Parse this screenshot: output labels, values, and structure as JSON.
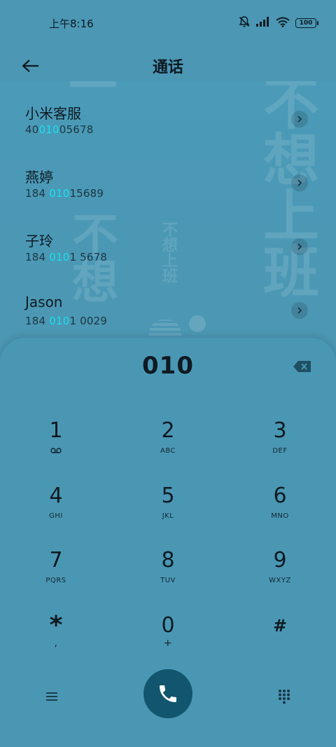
{
  "status_bar": {
    "time": "上午8:16",
    "battery": "100",
    "icons": [
      "mute-bell-icon",
      "signal-icon",
      "wifi-icon",
      "battery-icon"
    ]
  },
  "header": {
    "title": "通话",
    "back_icon": "arrow-left-icon"
  },
  "wallpaper": {
    "texts": [
      "不想上班",
      "不想上班",
      "不想"
    ]
  },
  "contacts": [
    {
      "name": "小米客服",
      "number_pre": "40",
      "number_match": "010",
      "number_post": "05678"
    },
    {
      "name": "燕婷",
      "number_pre": "184 ",
      "number_match": "010",
      "number_post": "15689"
    },
    {
      "name": "子玲",
      "number_pre": "184 ",
      "number_match": "010",
      "number_post": "1 5678"
    },
    {
      "name": "Jason",
      "number_pre": "184 ",
      "number_match": "010",
      "number_post": "1 0029"
    }
  ],
  "dialer": {
    "input": "010",
    "delete_icon": "backspace-icon",
    "keys": [
      {
        "digit": "1",
        "sub": ""
      },
      {
        "digit": "2",
        "sub": "ABC"
      },
      {
        "digit": "3",
        "sub": "DEF"
      },
      {
        "digit": "4",
        "sub": "GHI"
      },
      {
        "digit": "5",
        "sub": "JKL"
      },
      {
        "digit": "6",
        "sub": "MNO"
      },
      {
        "digit": "7",
        "sub": "PQRS"
      },
      {
        "digit": "8",
        "sub": "TUV"
      },
      {
        "digit": "9",
        "sub": "WXYZ"
      },
      {
        "digit": "*",
        "sub": ","
      },
      {
        "digit": "0",
        "sub": "+"
      },
      {
        "digit": "#",
        "sub": ""
      }
    ]
  },
  "bottom_bar": {
    "menu_icon": "menu-icon",
    "call_icon": "phone-icon",
    "keypad_icon": "keypad-icon"
  },
  "colors": {
    "background": "#4b97b4",
    "match_highlight": "#19e0f0",
    "call_button": "#12556e"
  }
}
